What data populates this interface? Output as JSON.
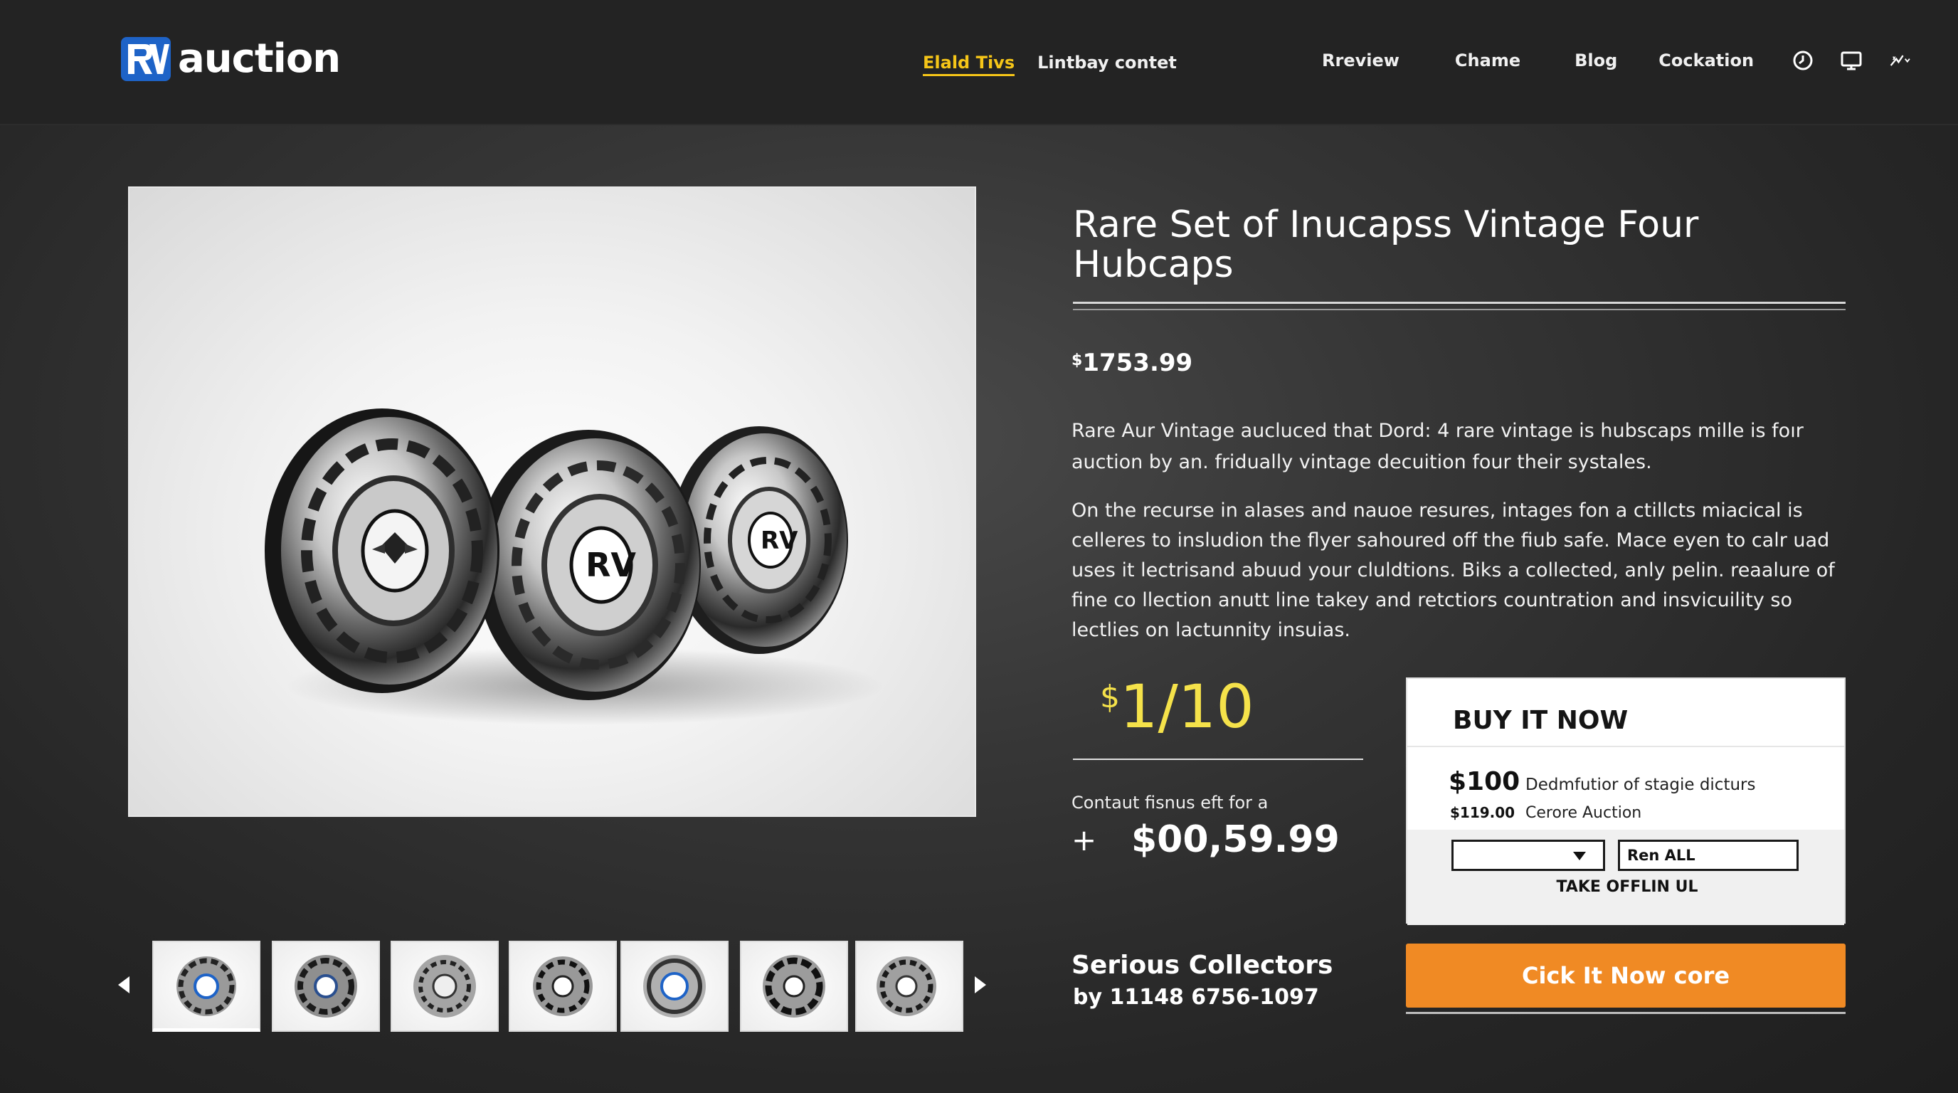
{
  "brand": {
    "name": "auction"
  },
  "header": {
    "subnav": {
      "active": "Elald Tivs",
      "other": "Lintbay contet"
    },
    "nav": [
      "Rreview",
      "Chame",
      "Blog",
      "Cockation"
    ],
    "icons": [
      "clock-icon",
      "monitor-icon",
      "settings-sparkle-icon"
    ]
  },
  "product": {
    "title": "Rare Set of Inucapss Vintage Four Hubcaps",
    "price_currency": "$",
    "price": "1753.99",
    "description_1": "Rare Aur Vintage aucluced that Dord: 4 rare vintage is hubscaps mille is foır auction by an. fridually vintage decuition four their systales.",
    "description_2": "On the recurse in alases and nauoe resures, intages fon a ctillcts miacical is celleres to insludion the flyer sahoured off the fiub safe. Mace eyen to calr uad uses it lectrisand abuud your cluldtions. Biks a collected, anly pelin. reaalure of fine co llection anutt line takey and retctiors countration and insvicuility so lectlies on lactunnity insuias."
  },
  "bid": {
    "currency": "$",
    "current": "1/10",
    "contact_label": "Contaut fisnus eft for a",
    "plus": "+",
    "contact_price": "$00,59.99"
  },
  "seller": {
    "title": "Serious Collectors",
    "subtitle": "by  11148 6756-1097"
  },
  "buy_now": {
    "title": "BUY IT NOW",
    "row1_amount": "$100",
    "row1_label": "Dedmfutior of stagie dicturs",
    "row2_amount": "$119.00",
    "row2_label": "Cerore Auction",
    "select_value": "",
    "input_value": "Ren ALL",
    "take_label": "TAKE OFFLIN UL"
  },
  "cta": {
    "label": "Cick It Now core"
  },
  "thumbnails": {
    "count": 7,
    "selected": 0
  },
  "colors": {
    "accent_yellow": "#f5c518",
    "bid_yellow": "#f5e24a",
    "cta_orange": "#f08a24",
    "brand_blue": "#1e63c7"
  }
}
